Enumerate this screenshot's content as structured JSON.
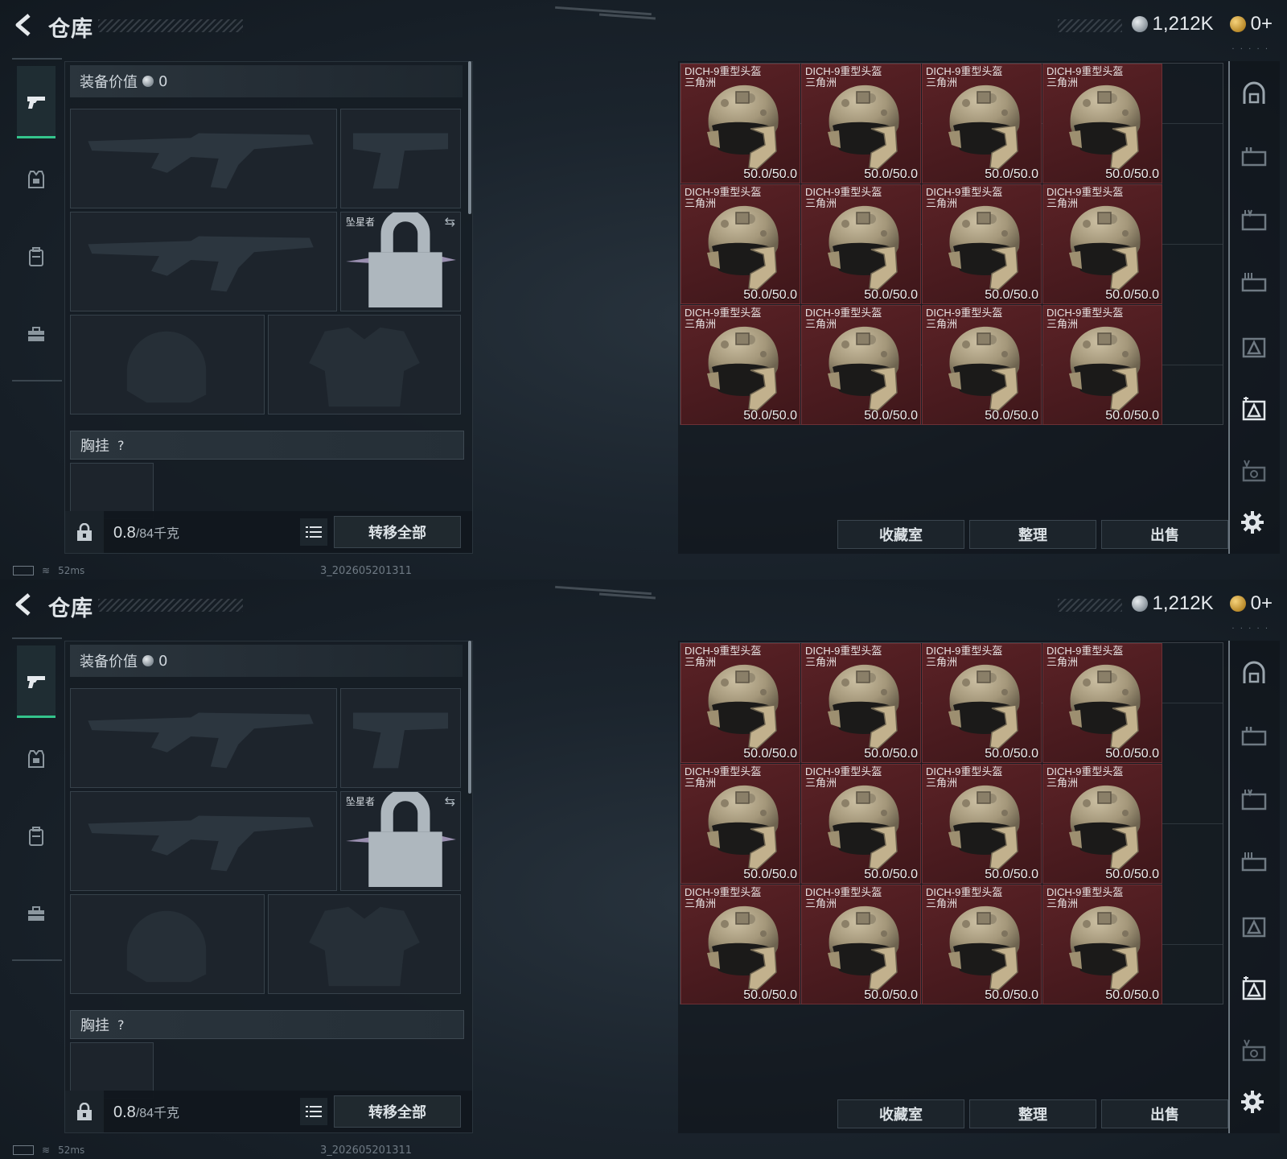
{
  "screens": [
    {
      "header": {
        "title": "仓库",
        "currency_silver": "1,212K",
        "currency_gold": "0+"
      },
      "equipment": {
        "value_label": "装备价值",
        "value": "0",
        "melee_label": "坠星者",
        "chest_label": "胸挂",
        "chest_help": "?",
        "weight_value": "0.8",
        "weight_unit": "/84千克",
        "transfer_label": "转移全部"
      },
      "inventory": {
        "items": [
          {
            "name": "DICH-9重型头盔\n三角洲",
            "durability": "50.0/50.0"
          },
          {
            "name": "DICH-9重型头盔\n三角洲",
            "durability": "50.0/50.0"
          },
          {
            "name": "DICH-9重型头盔\n三角洲",
            "durability": "50.0/50.0"
          },
          {
            "name": "DICH-9重型头盔\n三角洲",
            "durability": "50.0/50.0"
          },
          {
            "name": "DICH-9重型头盔\n三角洲",
            "durability": "50.0/50.0"
          },
          {
            "name": "DICH-9重型头盔\n三角洲",
            "durability": "50.0/50.0"
          },
          {
            "name": "DICH-9重型头盔\n三角洲",
            "durability": "50.0/50.0"
          },
          {
            "name": "DICH-9重型头盔\n三角洲",
            "durability": "50.0/50.0"
          },
          {
            "name": "DICH-9重型头盔\n三角洲",
            "durability": "50.0/50.0"
          },
          {
            "name": "DICH-9重型头盔\n三角洲",
            "durability": "50.0/50.0"
          },
          {
            "name": "DICH-9重型头盔\n三角洲",
            "durability": "50.0/50.0"
          },
          {
            "name": "DICH-9重型头盔\n三角洲",
            "durability": "50.0/50.0"
          }
        ],
        "buttons": {
          "collection": "收藏室",
          "sort": "整理",
          "sell": "出售"
        }
      },
      "status": {
        "ping": "52ms",
        "build_id": "3_202605201311"
      }
    },
    {
      "header": {
        "title": "仓库",
        "currency_silver": "1,212K",
        "currency_gold": "0+"
      },
      "equipment": {
        "value_label": "装备价值",
        "value": "0",
        "melee_label": "坠星者",
        "chest_label": "胸挂",
        "chest_help": "?",
        "weight_value": "0.8",
        "weight_unit": "/84千克",
        "transfer_label": "转移全部"
      },
      "inventory": {
        "items": [
          {
            "name": "DICH-9重型头盔\n三角洲",
            "durability": "50.0/50.0"
          },
          {
            "name": "DICH-9重型头盔\n三角洲",
            "durability": "50.0/50.0"
          },
          {
            "name": "DICH-9重型头盔\n三角洲",
            "durability": "50.0/50.0"
          },
          {
            "name": "DICH-9重型头盔\n三角洲",
            "durability": "50.0/50.0"
          },
          {
            "name": "DICH-9重型头盔\n三角洲",
            "durability": "50.0/50.0"
          },
          {
            "name": "DICH-9重型头盔\n三角洲",
            "durability": "50.0/50.0"
          },
          {
            "name": "DICH-9重型头盔\n三角洲",
            "durability": "50.0/50.0"
          },
          {
            "name": "DICH-9重型头盔\n三角洲",
            "durability": "50.0/50.0"
          },
          {
            "name": "DICH-9重型头盔\n三角洲",
            "durability": "50.0/50.0"
          },
          {
            "name": "DICH-9重型头盔\n三角洲",
            "durability": "50.0/50.0"
          },
          {
            "name": "DICH-9重型头盔\n三角洲",
            "durability": "50.0/50.0"
          },
          {
            "name": "DICH-9重型头盔\n三角洲",
            "durability": "50.0/50.0"
          }
        ],
        "buttons": {
          "collection": "收藏室",
          "sort": "整理",
          "sell": "出售"
        }
      },
      "status": {
        "ping": "52ms",
        "build_id": "3_202605201311"
      }
    }
  ],
  "icons": {
    "left_rail": [
      "pistol-icon",
      "armor-vest-icon",
      "backpack-icon",
      "toolbox-icon"
    ],
    "right_rail": [
      "helmet-rack-icon",
      "rack-2-icon",
      "rack-4-icon",
      "rack-3-icon",
      "rack-5-icon",
      "rack-6-icon",
      "rack-v-icon"
    ]
  },
  "colors": {
    "accent_green": "#34c48c",
    "item_bg_red": "#4a1b1f",
    "panel_dark": "#161d24"
  }
}
